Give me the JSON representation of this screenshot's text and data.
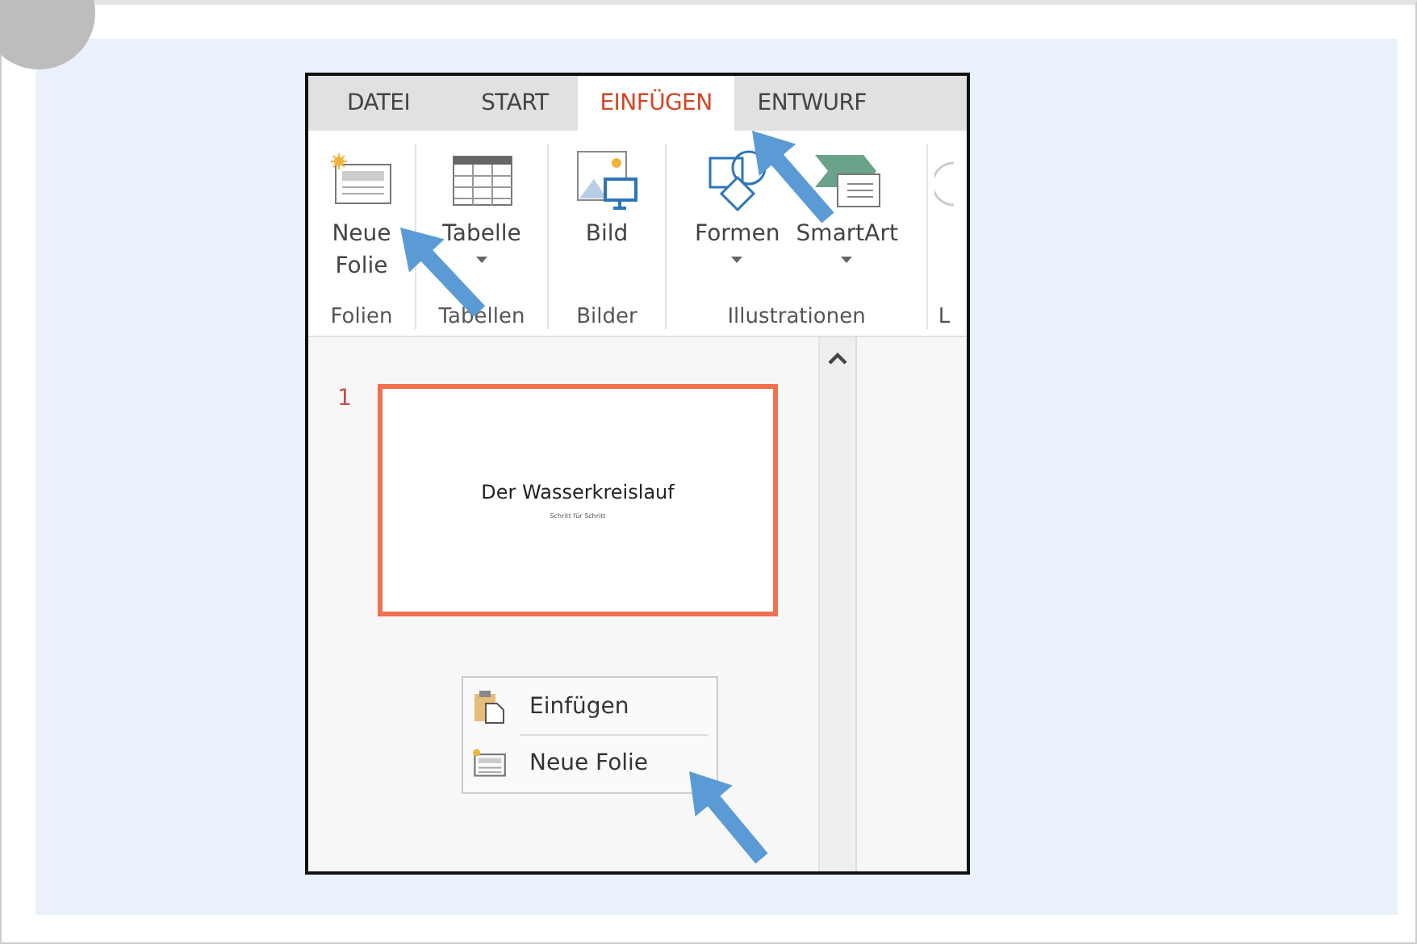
{
  "tabs": [
    {
      "label": "DATEI",
      "selected": false
    },
    {
      "label": "START",
      "selected": false
    },
    {
      "label": "EINFÜGEN",
      "selected": true
    },
    {
      "label": "ENTWURF",
      "selected": false
    }
  ],
  "ribbon_groups": [
    {
      "label": "Folien",
      "buttons": [
        {
          "label": "Neue Folie",
          "kind": "slide",
          "dropdown": false
        }
      ]
    },
    {
      "label": "Tabellen",
      "buttons": [
        {
          "label": "Tabelle",
          "kind": "table",
          "dropdown": true
        }
      ]
    },
    {
      "label": "Bilder",
      "buttons": [
        {
          "label": "Bild",
          "kind": "image",
          "dropdown": false
        }
      ]
    },
    {
      "label": "Illustrationen",
      "buttons": [
        {
          "label": "Formen",
          "kind": "shapes",
          "dropdown": true
        },
        {
          "label": "SmartArt",
          "kind": "smartart",
          "dropdown": true
        }
      ]
    },
    {
      "label": "L"
    }
  ],
  "slides": [
    {
      "number": "1",
      "title": "Der Wasserkreislauf",
      "subtitle": "Schritt für Schritt",
      "selected": true
    }
  ],
  "context_menu": [
    {
      "label": "Einfügen",
      "kind": "paste"
    },
    {
      "label": "Neue Folie",
      "kind": "slide"
    }
  ]
}
